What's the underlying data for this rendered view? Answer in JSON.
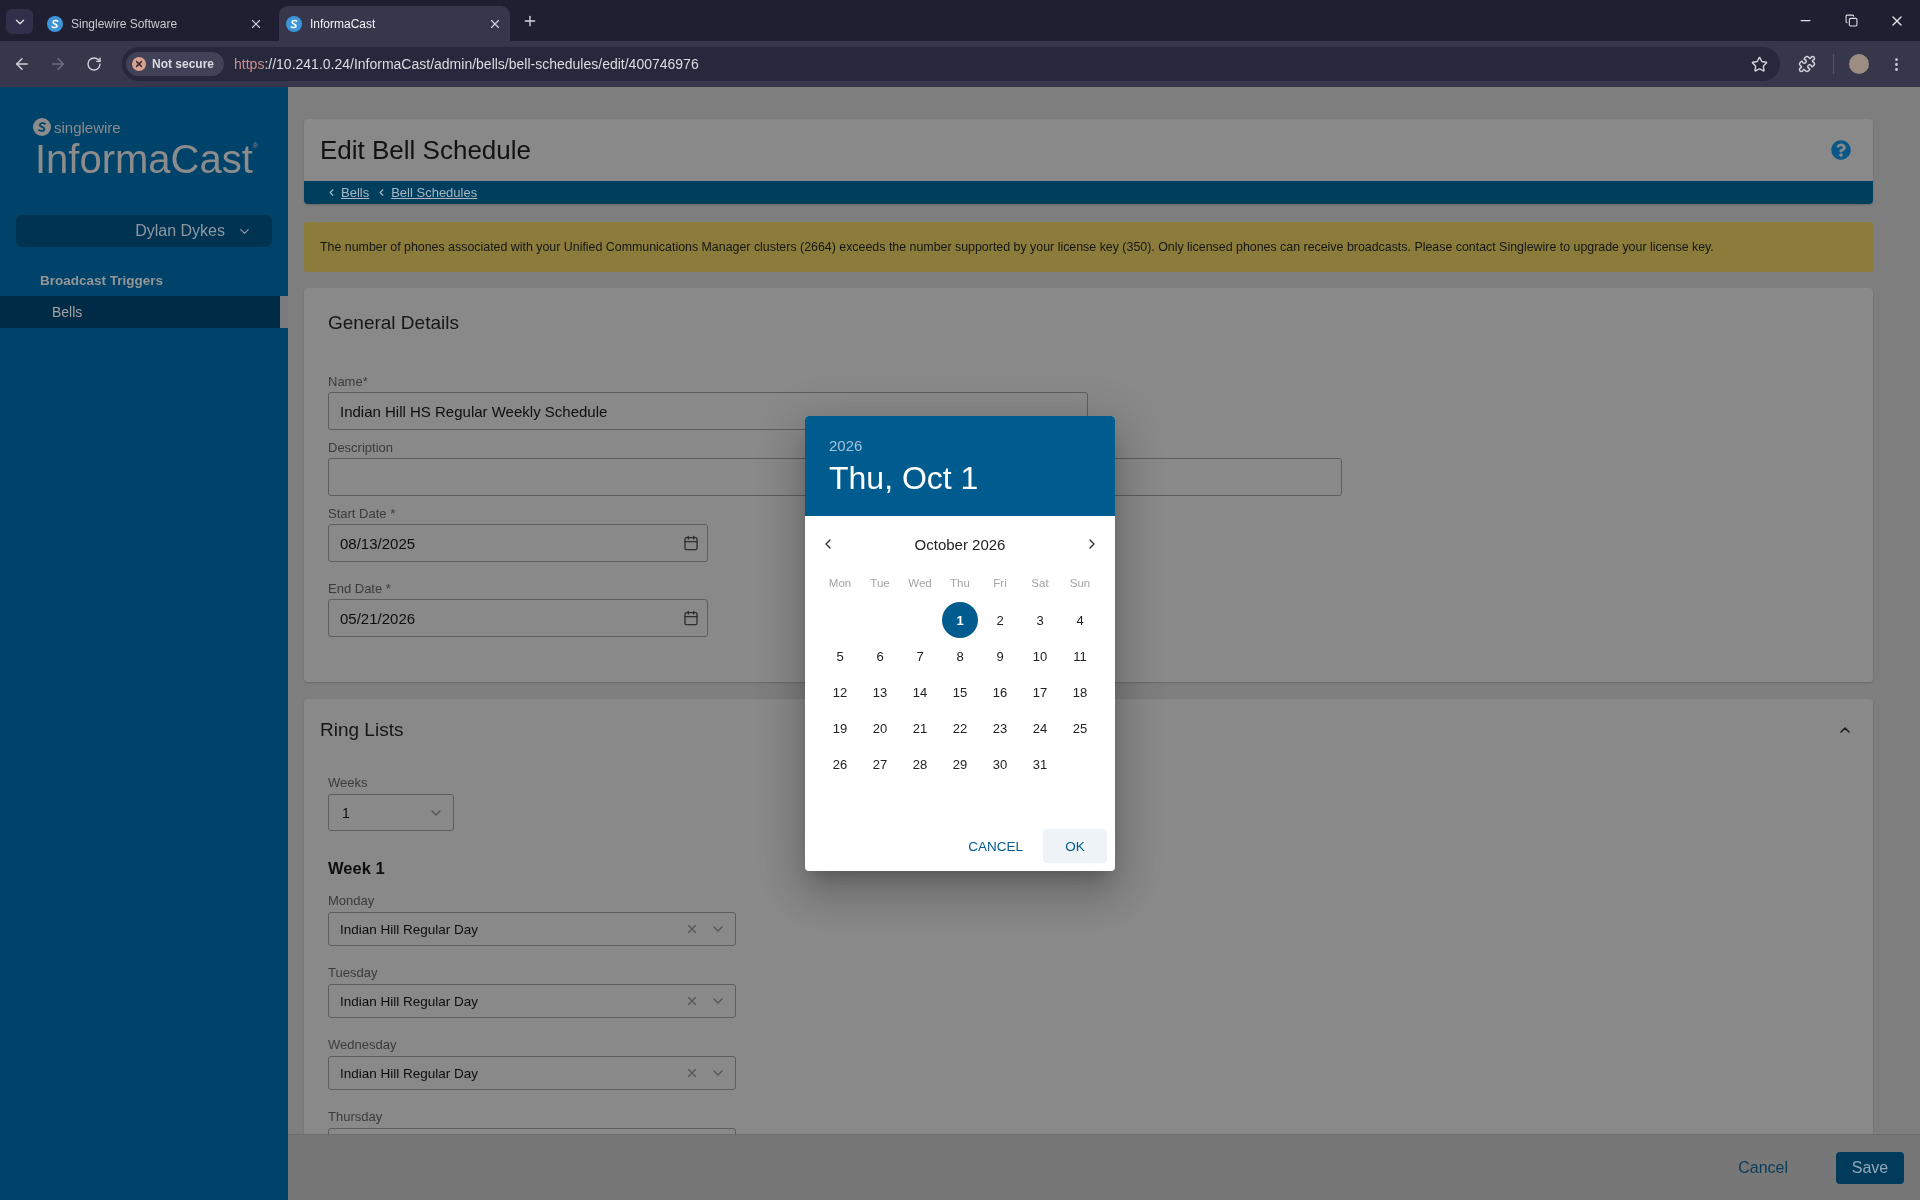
{
  "browser": {
    "tabs": [
      {
        "title": "Singlewire Software",
        "selected": false
      },
      {
        "title": "InformaCast",
        "selected": true
      }
    ],
    "forward_disabled": true,
    "security_label": "Not secure",
    "url_scheme": "https",
    "url_rest": "://10.241.0.24/InformaCast/admin/bells/bell-schedules/edit/400746976"
  },
  "sidebar": {
    "brand_small": "singlewire",
    "brand": "InformaCast$^{®}$",
    "user": "Dylan Dykes",
    "sections": [
      {
        "title": "Broadcast Triggers",
        "items": [
          {
            "label": "Bells",
            "selected": true
          }
        ]
      }
    ]
  },
  "header": {
    "title": "Edit Bell Schedule",
    "breadcrumbs": [
      "Bells",
      "Bell Schedules"
    ]
  },
  "alert": "The number of phones associated with your Unified Communications Manager clusters (2664) exceeds the number supported by your license key (350). Only licensed phones can receive broadcasts. Please contact Singlewire to upgrade your license key.",
  "general_details": {
    "title": "General Details",
    "fields": [
      {
        "kind": "text",
        "label": "Name*",
        "value": "Indian Hill HS Regular Weekly Schedule"
      },
      {
        "kind": "multiline",
        "label": "Description"
      },
      {
        "kind": "date",
        "label": "Start Date *",
        "value": "08/13/2025"
      },
      {
        "kind": "date",
        "label": "End Date *",
        "value": "05/21/2026"
      }
    ]
  },
  "ring_lists": {
    "title": "Ring Lists",
    "expanded": true,
    "weeks": {
      "label": "Weeks",
      "value": "1"
    },
    "week_title": "Week 1",
    "days": [
      {
        "label": "Monday",
        "value": "Indian Hill Regular Day"
      },
      {
        "label": "Tuesday",
        "value": "Indian Hill Regular Day"
      },
      {
        "label": "Wednesday",
        "value": "Indian Hill Regular Day"
      },
      {
        "label": "Thursday"
      }
    ]
  },
  "footer": {
    "cancel": "Cancel",
    "save": "Save"
  },
  "date_picker": {
    "year": "2026",
    "date": "Thu, Oct 1",
    "month": "October 2026",
    "weekdays": [
      "Mon",
      "Tue",
      "Wed",
      "Thu",
      "Fri",
      "Sat",
      "Sun"
    ],
    "rows": [
      [
        "",
        "",
        "",
        {
          "label": "1",
          "selected": true
        },
        {
          "label": "2",
          "selected": false
        },
        {
          "label": "3",
          "selected": false
        },
        {
          "label": "4",
          "selected": false
        }
      ],
      [
        {
          "label": "5",
          "selected": false
        },
        {
          "label": "6",
          "selected": false
        },
        {
          "label": "7",
          "selected": false
        },
        {
          "label": "8",
          "selected": false
        },
        {
          "label": "9",
          "selected": false
        },
        {
          "label": "10",
          "selected": false
        },
        {
          "label": "11",
          "selected": false
        }
      ],
      [
        {
          "label": "12",
          "selected": false
        },
        {
          "label": "13",
          "selected": false
        },
        {
          "label": "14",
          "selected": false
        },
        {
          "label": "15",
          "selected": false
        },
        {
          "label": "16",
          "selected": false
        },
        {
          "label": "17",
          "selected": false
        },
        {
          "label": "18",
          "selected": false
        }
      ],
      [
        {
          "label": "19",
          "selected": false
        },
        {
          "label": "20",
          "selected": false
        },
        {
          "label": "21",
          "selected": false
        },
        {
          "label": "22",
          "selected": false
        },
        {
          "label": "23",
          "selected": false
        },
        {
          "label": "24",
          "selected": false
        },
        {
          "label": "25",
          "selected": false
        }
      ],
      [
        {
          "label": "26",
          "selected": false
        },
        {
          "label": "27",
          "selected": false
        },
        {
          "label": "28",
          "selected": false
        },
        {
          "label": "29",
          "selected": false
        },
        {
          "label": "30",
          "selected": false
        },
        {
          "label": "31",
          "selected": false
        }
      ]
    ],
    "buttons": [
      {
        "label": "CANCEL",
        "focused": false
      },
      {
        "label": "OK",
        "focused": true
      }
    ]
  }
}
